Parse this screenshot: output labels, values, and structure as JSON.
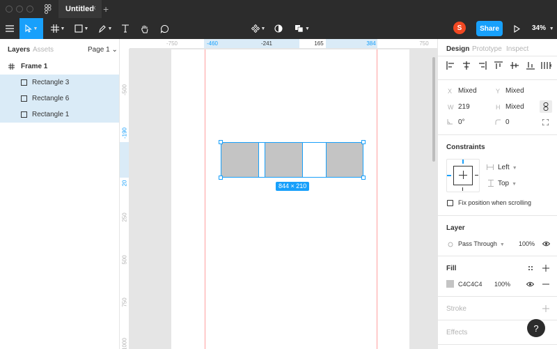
{
  "window": {
    "tab_title": "Untitled",
    "tab_close": "×",
    "new_tab": "+"
  },
  "toolbar": {
    "user_initial": "S",
    "share_label": "Share",
    "zoom_label": "34%"
  },
  "left_panel": {
    "tabs": [
      "Layers",
      "Assets"
    ],
    "page_selector": "Page 1 ⌄",
    "layers": [
      {
        "name": "Frame 1",
        "selected": false
      },
      {
        "name": "Rectangle 3",
        "selected": true
      },
      {
        "name": "Rectangle 6",
        "selected": true
      },
      {
        "name": "Rectangle 1",
        "selected": true
      }
    ]
  },
  "rulers": {
    "top": [
      "-750",
      "-460",
      "-241",
      "165",
      "384",
      "750"
    ],
    "left": [
      "-500",
      "-190",
      "20",
      "250",
      "500",
      "750",
      "1000"
    ]
  },
  "canvas": {
    "selection_label": "844 × 210",
    "fill_color": "#c4c4c4",
    "accent_color": "#18a0fb"
  },
  "right_panel": {
    "tabs": [
      "Design",
      "Prototype",
      "Inspect"
    ],
    "x_label": "X",
    "x_value": "Mixed",
    "y_label": "Y",
    "y_value": "Mixed",
    "w_label": "W",
    "w_value": "219",
    "h_label": "H",
    "h_value": "Mixed",
    "rotation": "0°",
    "radius": "0",
    "constraints_title": "Constraints",
    "constraint_h": "Left",
    "constraint_v": "Top",
    "fix_position": "Fix position when scrolling",
    "layer_title": "Layer",
    "blend_mode": "Pass Through",
    "layer_opacity": "100%",
    "fill_title": "Fill",
    "fill_hex": "C4C4C4",
    "fill_opacity": "100%",
    "stroke_title": "Stroke",
    "effects_title": "Effects"
  },
  "help": "?"
}
